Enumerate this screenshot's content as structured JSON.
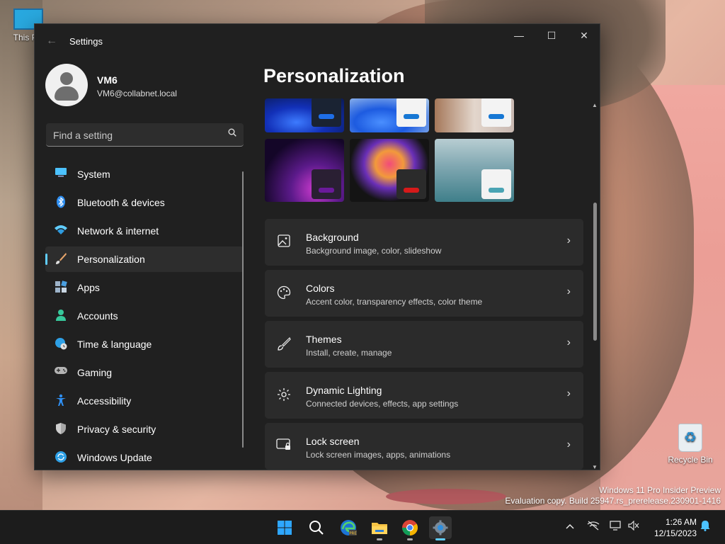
{
  "desktop": {
    "icons": [
      {
        "label": "This PC",
        "icon": "monitor-icon"
      },
      {
        "label": "Recycle Bin",
        "icon": "recycle-bin-icon"
      }
    ],
    "watermark": {
      "line1": "Windows 11 Pro Insider Preview",
      "line2": "Evaluation copy. Build 25947.rs_prerelease.230901-1416"
    }
  },
  "window": {
    "title": "Settings",
    "controls": {
      "minimize": "—",
      "maximize": "☐",
      "close": "✕"
    }
  },
  "profile": {
    "name": "VM6",
    "email": "VM6@collabnet.local"
  },
  "search": {
    "placeholder": "Find a setting"
  },
  "nav": {
    "items": [
      {
        "label": "System",
        "icon": "monitor-icon",
        "color": "#4cc2ff"
      },
      {
        "label": "Bluetooth & devices",
        "icon": "bluetooth-icon",
        "color": "#2f8ff2"
      },
      {
        "label": "Network & internet",
        "icon": "wifi-icon",
        "color": "#60cdff"
      },
      {
        "label": "Personalization",
        "icon": "brush-icon",
        "color": "#e6a46a",
        "active": true
      },
      {
        "label": "Apps",
        "icon": "apps-icon",
        "color": "#9db3c9"
      },
      {
        "label": "Accounts",
        "icon": "person-icon",
        "color": "#37c99c"
      },
      {
        "label": "Time & language",
        "icon": "globe-clock-icon",
        "color": "#2ea0e6"
      },
      {
        "label": "Gaming",
        "icon": "gamepad-icon",
        "color": "#b4b4b4"
      },
      {
        "label": "Accessibility",
        "icon": "accessibility-icon",
        "color": "#2f8ff2"
      },
      {
        "label": "Privacy & security",
        "icon": "shield-icon",
        "color": "#a7a7a7"
      },
      {
        "label": "Windows Update",
        "icon": "sync-icon",
        "color": "#2ea0e6"
      }
    ]
  },
  "main": {
    "title": "Personalization",
    "themes": [
      {
        "name": "bloom-blue",
        "accent": "#1e6ee8"
      },
      {
        "name": "bloom-light",
        "accent": "#1677d4"
      },
      {
        "name": "flowers-light",
        "accent": "#1677d4"
      },
      {
        "name": "glow-purple",
        "accent": "#6a1a9a"
      },
      {
        "name": "captured-motion",
        "accent": "#d61a1a"
      },
      {
        "name": "sunrise-lake",
        "accent": "#4aa4b4"
      }
    ],
    "cards": [
      {
        "title": "Background",
        "subtitle": "Background image, color, slideshow",
        "icon": "image-icon"
      },
      {
        "title": "Colors",
        "subtitle": "Accent color, transparency effects, color theme",
        "icon": "palette-icon"
      },
      {
        "title": "Themes",
        "subtitle": "Install, create, manage",
        "icon": "brush-icon"
      },
      {
        "title": "Dynamic Lighting",
        "subtitle": "Connected devices, effects, app settings",
        "icon": "lighting-icon"
      },
      {
        "title": "Lock screen",
        "subtitle": "Lock screen images, apps, animations",
        "icon": "lock-screen-icon"
      }
    ]
  },
  "taskbar": {
    "apps": [
      {
        "name": "start",
        "icon": "windows-icon"
      },
      {
        "name": "search",
        "icon": "search-icon"
      },
      {
        "name": "edge",
        "icon": "edge-icon"
      },
      {
        "name": "file-explorer",
        "icon": "folder-icon"
      },
      {
        "name": "chrome",
        "icon": "chrome-icon"
      },
      {
        "name": "settings",
        "icon": "gear-icon",
        "active": true
      }
    ],
    "time": "1:26 AM",
    "date": "12/15/2023"
  }
}
